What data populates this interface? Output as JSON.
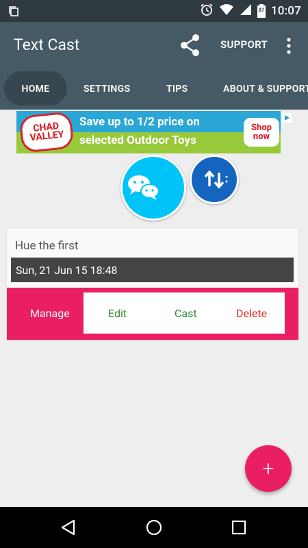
{
  "status_bar": {
    "time": "10:07",
    "battery": "87"
  },
  "app_bar": {
    "title": "Text Cast",
    "support_label": "SUPPORT",
    "tabs": [
      {
        "label": "HOME"
      },
      {
        "label": "SETTINGS"
      },
      {
        "label": "TIPS"
      },
      {
        "label": "ABOUT & SUPPORT"
      }
    ]
  },
  "ad": {
    "brand": "CHAD VALLEY",
    "line1": "Save up to 1/2 price on",
    "line2": "selected Outdoor Toys",
    "cta": "Shop now"
  },
  "card": {
    "title": "Hue the first",
    "date": "Sun, 21 Jun 15 18:48",
    "manage_label": "Manage",
    "actions": {
      "edit": "Edit",
      "cast": "Cast",
      "delete": "Delete"
    }
  },
  "fab": {
    "label": "+"
  },
  "colors": {
    "status_bar": "#2f3a40",
    "app_bar": "#455a64",
    "accent": "#e91e63",
    "wechat": "#00c4f8",
    "swap": "#1565c0",
    "action_green": "#2e8b2e",
    "action_red": "#e5281f"
  },
  "icons": [
    "copy-icon",
    "alarm-icon",
    "wifi-icon",
    "signal-icon",
    "battery-icon",
    "share-icon",
    "more-vert-icon",
    "chat-bubbles-icon",
    "swap-vert-icon",
    "add-icon",
    "back-icon",
    "home-icon",
    "recents-icon"
  ]
}
